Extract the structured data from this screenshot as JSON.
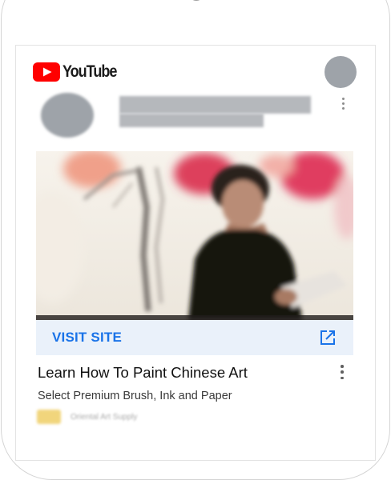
{
  "app": {
    "logo_text": "YouTube"
  },
  "colors": {
    "youtube_red": "#ff0000",
    "cta_text": "#1a73e8",
    "cta_background": "#eaf1fa",
    "placeholder_gray": "#9ea3a9"
  },
  "icons": {
    "logo": "youtube-play-icon",
    "menu": "more-vertical-icon",
    "cta": "open-in-new-icon"
  },
  "ad": {
    "cta_label": "VISIT SITE",
    "title": "Learn How To Paint Chinese Art",
    "description": "Select Premium Brush, Ink and Paper",
    "domain": "Oriental Art Supply"
  }
}
